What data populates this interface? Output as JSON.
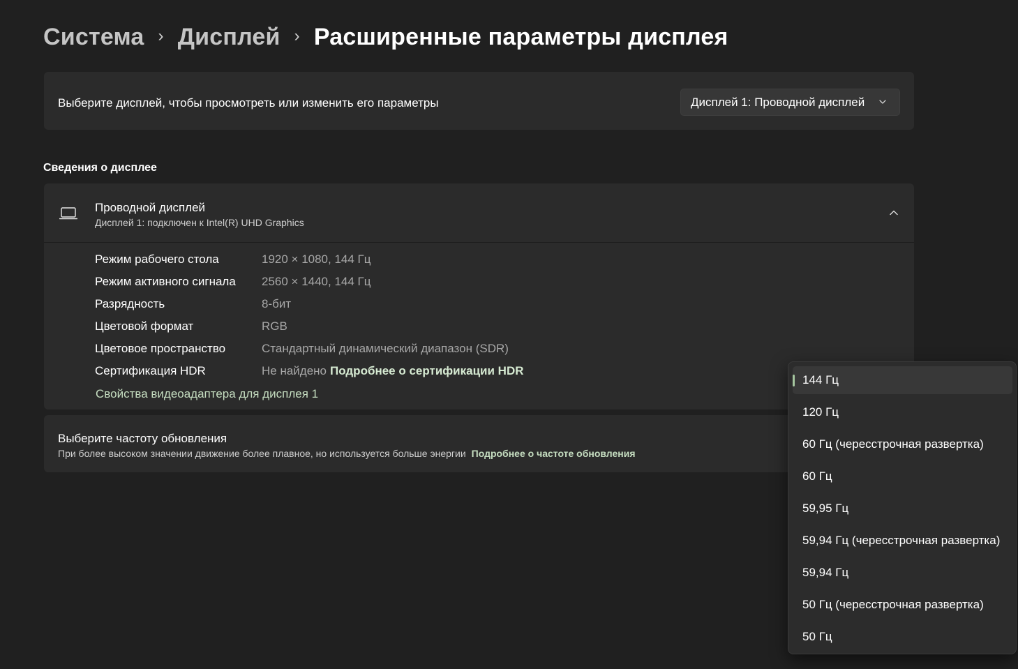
{
  "breadcrumb": {
    "items": [
      "Система",
      "Дисплей"
    ],
    "current": "Расширенные параметры дисплея",
    "separator": "›"
  },
  "display_select": {
    "label": "Выберите дисплей, чтобы просмотреть или изменить его параметры",
    "value": "Дисплей 1: Проводной дисплей"
  },
  "info_section": {
    "title": "Сведения о дисплее",
    "header_title": "Проводной дисплей",
    "header_subtitle": "Дисплей 1: подключен к Intel(R) UHD Graphics",
    "rows": [
      {
        "key": "Режим рабочего стола",
        "value": "1920 × 1080, 144 Гц"
      },
      {
        "key": "Режим активного сигнала",
        "value": "2560 × 1440, 144 Гц"
      },
      {
        "key": "Разрядность",
        "value": "8-бит"
      },
      {
        "key": "Цветовой формат",
        "value": "RGB"
      },
      {
        "key": "Цветовое пространство",
        "value": "Стандартный динамический диапазон (SDR)"
      },
      {
        "key": "Сертификация HDR",
        "value": "Не найдено",
        "link": "Подробнее о сертификации HDR"
      }
    ],
    "adapter_link": "Свойства видеоадаптера для дисплея 1"
  },
  "refresh": {
    "title": "Выберите частоту обновления",
    "description": "При более высоком значении движение более плавное, но используется больше энергии",
    "link": "Подробнее о частоте обновления"
  },
  "refresh_options": {
    "selected": "144 Гц",
    "items": [
      "144 Гц",
      "120 Гц",
      "60 Гц (чересстрочная развертка)",
      "60 Гц",
      "59,95 Гц",
      "59,94 Гц (чересстрочная развертка)",
      "59,94 Гц",
      "50 Гц (чересстрочная развертка)",
      "50 Гц"
    ]
  },
  "colors": {
    "background": "#202020",
    "card": "#2b2b2b",
    "accent": "#a6c7a0",
    "link": "#c6dec1"
  },
  "icons": {
    "monitor": "laptop-monitor-icon",
    "collapse": "chevron-up-icon",
    "combo": "chevron-down-icon"
  }
}
